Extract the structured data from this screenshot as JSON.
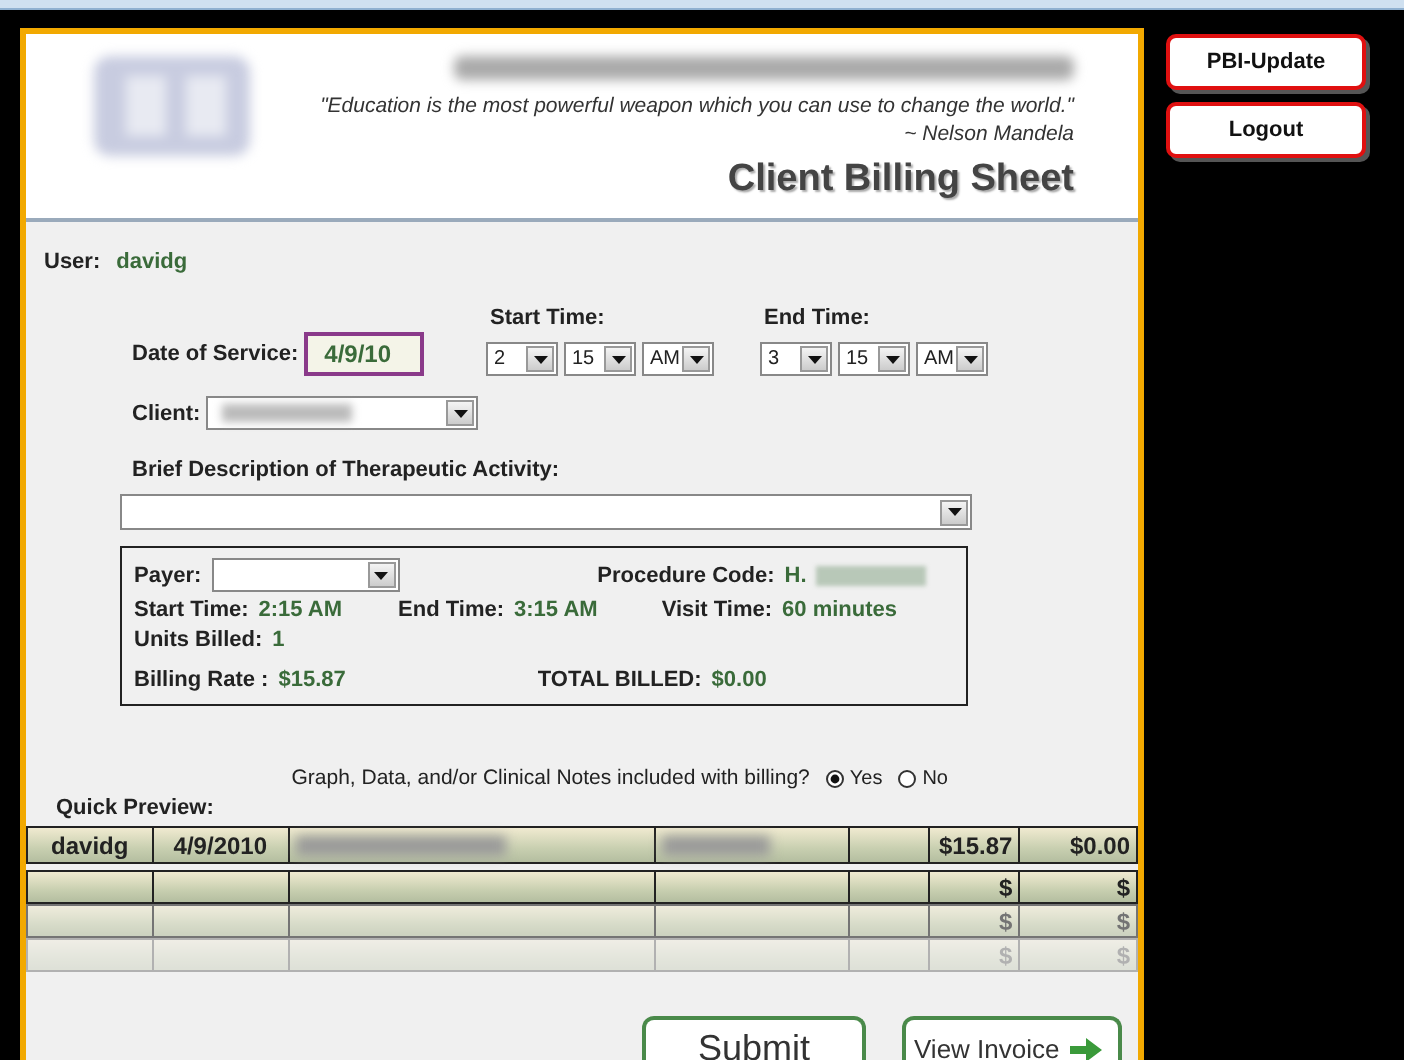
{
  "header": {
    "quote": "\"Education is the most powerful weapon which you can use to change the world.\"",
    "attribution": "~ Nelson Mandela",
    "title": "Client Billing Sheet"
  },
  "side_buttons": [
    "PBI-Update",
    "Logout"
  ],
  "user": {
    "label": "User:",
    "value": "davidg"
  },
  "date_of_service": {
    "label": "Date of Service:",
    "value": "4/9/10"
  },
  "start_time": {
    "label": "Start Time:",
    "hour": "2",
    "minute": "15",
    "period": "AM"
  },
  "end_time": {
    "label": "End Time:",
    "hour": "3",
    "minute": "15",
    "period": "AM"
  },
  "client": {
    "label": "Client:"
  },
  "description": {
    "label": "Brief Description of Therapeutic Activity:"
  },
  "summary": {
    "payer_label": "Payer:",
    "procedure_code_label": "Procedure Code:",
    "procedure_code": "H.",
    "start_label": "Start Time:",
    "start_value": "2:15 AM",
    "end_label": "End Time:",
    "end_value": "3:15 AM",
    "visit_label": "Visit Time:",
    "visit_value": "60 minutes",
    "units_label": "Units Billed:",
    "units_value": "1",
    "rate_label": "Billing Rate :",
    "rate_value": "$15.87",
    "total_label": "TOTAL BILLED:",
    "total_value": "$0.00"
  },
  "question": {
    "text": "Graph, Data, and/or Clinical Notes included with billing?",
    "options": [
      {
        "label": "Yes",
        "selected": true
      },
      {
        "label": "No",
        "selected": false
      }
    ]
  },
  "preview": {
    "label": "Quick Preview:",
    "rows": [
      [
        {
          "kind": "text",
          "text": "davidg"
        },
        {
          "kind": "text",
          "text": "4/9/2010"
        },
        {
          "kind": "redacted"
        },
        {
          "kind": "redacted"
        },
        {
          "kind": "empty"
        },
        {
          "kind": "text",
          "text": "$15.87"
        },
        {
          "kind": "text",
          "text": "$0.00"
        }
      ],
      [
        {
          "kind": "empty"
        },
        {
          "kind": "empty"
        },
        {
          "kind": "empty"
        },
        {
          "kind": "empty"
        },
        {
          "kind": "empty"
        },
        {
          "kind": "text",
          "text": "$"
        },
        {
          "kind": "text",
          "text": "$"
        }
      ],
      [
        {
          "kind": "empty"
        },
        {
          "kind": "empty"
        },
        {
          "kind": "empty"
        },
        {
          "kind": "empty"
        },
        {
          "kind": "empty"
        },
        {
          "kind": "text",
          "text": "$"
        },
        {
          "kind": "text",
          "text": "$"
        }
      ],
      [
        {
          "kind": "empty"
        },
        {
          "kind": "empty"
        },
        {
          "kind": "empty"
        },
        {
          "kind": "empty"
        },
        {
          "kind": "empty"
        },
        {
          "kind": "text",
          "text": "$"
        },
        {
          "kind": "text",
          "text": "$"
        }
      ]
    ]
  },
  "actions": [
    {
      "label": "Submit",
      "kind": "plain"
    },
    {
      "label": "View Invoice",
      "kind": "arrow"
    }
  ]
}
